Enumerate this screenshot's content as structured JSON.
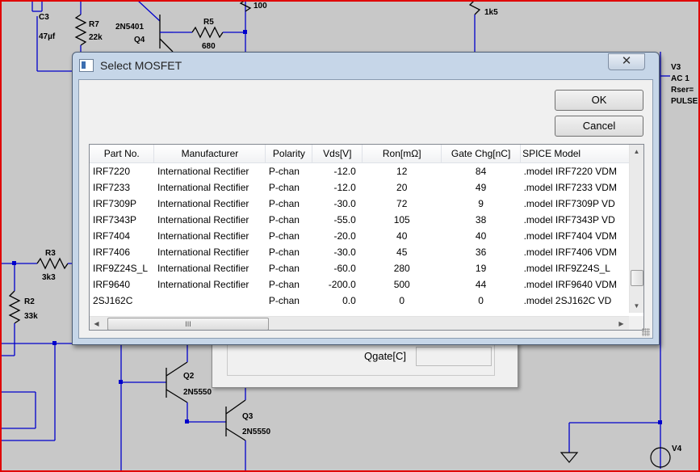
{
  "schematic": {
    "labels": {
      "c3": "C3",
      "c3_val": "47µf",
      "r7": "R7",
      "r7_val": "22k",
      "q4_type": "2N5401",
      "q4": "Q4",
      "r5": "R5",
      "r5_val": "680",
      "top_val": "100",
      "right_val": "1k5",
      "v3": "V3",
      "v3_ac": "AC 1",
      "v3_rser": "Rser=",
      "v3_pulse": "PULSE",
      "r3": "R3",
      "r3_val": "3k3",
      "r2": "R2",
      "r2_val": "33k",
      "q2": "Q2",
      "q2_type": "2N5550",
      "q3": "Q3",
      "q3_type": "2N5550",
      "v4": "V4"
    }
  },
  "background_dialog": {
    "qgate_label": "Qgate[C]"
  },
  "dialog": {
    "title": "Select MOSFET",
    "close_glyph": "✕",
    "ok_label": "OK",
    "cancel_label": "Cancel",
    "columns": [
      "Part No.",
      "Manufacturer",
      "Polarity",
      "Vds[V]",
      "Ron[mΩ]",
      "Gate Chg[nC]",
      "SPICE Model"
    ],
    "rows": [
      [
        "IRF7220",
        "International Rectifier",
        "P-chan",
        "-12.0",
        "12",
        "84",
        ".model IRF7220 VDM"
      ],
      [
        "IRF7233",
        "International Rectifier",
        "P-chan",
        "-12.0",
        "20",
        "49",
        ".model IRF7233 VDM"
      ],
      [
        "IRF7309P",
        "International Rectifier",
        "P-chan",
        "-30.0",
        "72",
        "9",
        ".model IRF7309P VD"
      ],
      [
        "IRF7343P",
        "International Rectifier",
        "P-chan",
        "-55.0",
        "105",
        "38",
        ".model IRF7343P VD"
      ],
      [
        "IRF7404",
        "International Rectifier",
        "P-chan",
        "-20.0",
        "40",
        "40",
        ".model IRF7404 VDM"
      ],
      [
        "IRF7406",
        "International Rectifier",
        "P-chan",
        "-30.0",
        "45",
        "36",
        ".model IRF7406 VDM"
      ],
      [
        "IRF9Z24S_L",
        "International Rectifier",
        "P-chan",
        "-60.0",
        "280",
        "19",
        ".model IRF9Z24S_L"
      ],
      [
        "IRF9640",
        "International Rectifier",
        "P-chan",
        "-200.0",
        "500",
        "44",
        ".model IRF9640 VDM"
      ],
      [
        "2SJ162C",
        "",
        "P-chan",
        "0.0",
        "0",
        "0",
        ".model 2SJ162C VD"
      ]
    ],
    "hscroll_grip": "III"
  },
  "colors": {
    "wire": "#0000cc",
    "frame": "#e00000",
    "dialog_border": "#c6d6e8"
  }
}
